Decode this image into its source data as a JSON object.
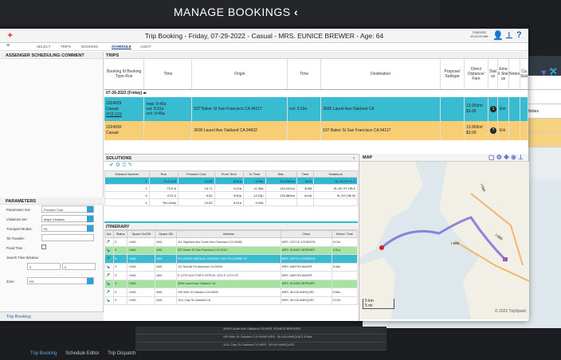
{
  "header": {
    "title": "MANAGE BOOKINGS",
    "chevron": "‹"
  },
  "window": {
    "title": "Trip Booking  - Friday, 07-29-2022 - Casual - MRS. EUNICE BREWER - Age: 64",
    "date": "7/26/2022",
    "time": "10:22:20 AM"
  },
  "nav": [
    "SELECT",
    "TRIPS",
    "BOOKING",
    "SCHEDULE",
    "AUDIT"
  ],
  "left": {
    "heading": "ASSENGER SCHEDULING COMMENT",
    "params_heading": "PARAMETERS",
    "params": [
      {
        "label": "Parameters Set:",
        "value": "Provider Cost"
      },
      {
        "label": "Violations Set:",
        "value": "Major Violation"
      },
      {
        "label": "Transport Modes:",
        "value": "RL"
      },
      {
        "label": "Tik Transfer:",
        "value": ""
      },
      {
        "label": "Fixed Time :",
        "value": ""
      },
      {
        "label": "Search Time Window:",
        "value": ""
      },
      {
        "label": "Zone:",
        "value": "RS"
      }
    ],
    "window_from": "0",
    "window_to": "0",
    "footer": "Trip Booking"
  },
  "trips": {
    "heading": "TRIPS",
    "cols": [
      "Booking Id Booking Type Run",
      "Time",
      "Origin",
      "Time",
      "Destination",
      "Purpose/ Subtype",
      "Direct Distance/ Fare",
      "Stat us",
      "Ema il Stat us",
      "Notes",
      "Ca Stat"
    ],
    "date_row": "07-29-2022 (Friday)",
    "rows": [
      {
        "id": "1024929",
        "type": "Casual",
        "run": "XYZ-123",
        "t1": "resp: 8:45a",
        "t2": "est: 8:31a",
        "t3": "sch: 8:45a",
        "origin": "537 Baker St San Francisco CA 94117",
        "time2": "est: 9:19a",
        "dest": "3695 Laurel Ave Oakland CA",
        "dist": "13.953ml",
        "fare": "$3.00",
        "status": "1"
      },
      {
        "id": "1024930",
        "type": "Casual",
        "run": "",
        "t1": "",
        "t2": "",
        "t3": "",
        "origin": "3695 Laurel Ave Oakland CA 94602",
        "time2": "",
        "dest": "537 Baker St San Francisco CA 94117",
        "dist": "13.953ml",
        "fare": "$3.00",
        "status": "?"
      }
    ]
  },
  "solutions": {
    "heading": "SOLUTIONS",
    "cols": [
      "Solution Number",
      "Run",
      "Provider Cost",
      "From Time",
      "To Time",
      "Dist.",
      "Time",
      "Violations"
    ],
    "rows": [
      [
        "1",
        "XYZ-123",
        "11.05",
        "8:31a",
        "9:19a",
        "222.052mi",
        "9h11",
        "SL:S1 PI:+C-1"
      ],
      [
        "2",
        "TEX-6",
        "15.71",
        "9:22a",
        "11:28a",
        "134.201mi",
        "4h58",
        "SL:S2 VT OB:2"
      ],
      [
        "3",
        "XYZ-4",
        "5.82",
        "9:50a",
        "12:23p",
        "135.889mi",
        "6h18",
        "SL:S3 OB:30"
      ],
      [
        "4",
        "Tex-Untry",
        "10.83",
        "9:41a",
        "9:44a",
        "",
        "",
        ""
      ]
    ]
  },
  "itinerary": {
    "heading": "ITINERARY",
    "cols": [
      "Act.",
      "Status",
      "Space On/Off",
      "Space OB",
      "Address",
      "Client",
      "Sched. Time"
    ],
    "rows": [
      [
        "S",
        "+AM1",
        "AM1",
        "111 Highland Ave South San Francisco CA 94080",
        "MRS. DOYLE JOHNSON",
        "8:15a"
      ],
      [
        "S",
        "+AM1",
        "AM1",
        "537 Baker St San Francisco CA 94117",
        "MRS. EUNICE BREWER",
        "8:31a"
      ],
      [
        "S",
        "+AM1",
        "AM1",
        "FILLMORE MEDICAL CENTER, 1621 FILLMORE ST",
        "MRS. DOYLE JOHNSON",
        ""
      ],
      [
        "S",
        "+AM1",
        "AM1",
        "111 Norfolk Rd Alameda CA 94501",
        "MRS. MARTIN BAKER",
        "8:46a"
      ],
      [
        "S",
        "+AM1",
        "AM1",
        "E 12TH DOCTOR'S OFFICE, 3311 E 12TH ST",
        "MRS. MARTIN BAKER",
        ""
      ],
      [
        "S",
        "+AM1",
        "",
        "3695 Laurel Ave Oakland CA",
        "MRS. EUNICE BREWER",
        ""
      ],
      [
        "S",
        "+AM1",
        "AM1",
        "430 60th St Oakland CA 94609",
        "MRS. SILVIA MARQUEZ",
        "8:56a"
      ],
      [
        "S",
        "+AM1",
        "AM1",
        "1111 Clay St Oakland CA",
        "MRS. SILVIA MARQUEZ",
        "9:10a"
      ]
    ]
  },
  "map": {
    "heading": "MAP",
    "scale_km": "5 km",
    "scale_mi": "5 mi",
    "copyright": "© 2022 TripSpark",
    "road_labels": [
      "I-580",
      "I-880",
      "I-580"
    ]
  },
  "bottom": {
    "tabs": [
      "Trip Booking",
      "Schedule Editor",
      "Trip Dispatch"
    ],
    "rows": [
      "3695 Laurel Ave Oakland CA        MRS. EUNICE BREWER",
      "430 60th St Oakland CA 94609     MRS. SILVIA MARQUEZ        8:56a",
      "1111 Clay St Oakland CA           MRS. SILVIA MARQUEZ"
    ]
  },
  "bgwin": {
    "notes": "Notes",
    "call": "Call Status"
  },
  "colors": {
    "accent": "#37bcd1",
    "amber": "#f8cd73",
    "green": "#a6e3a1",
    "route": "#7b6fd9"
  }
}
